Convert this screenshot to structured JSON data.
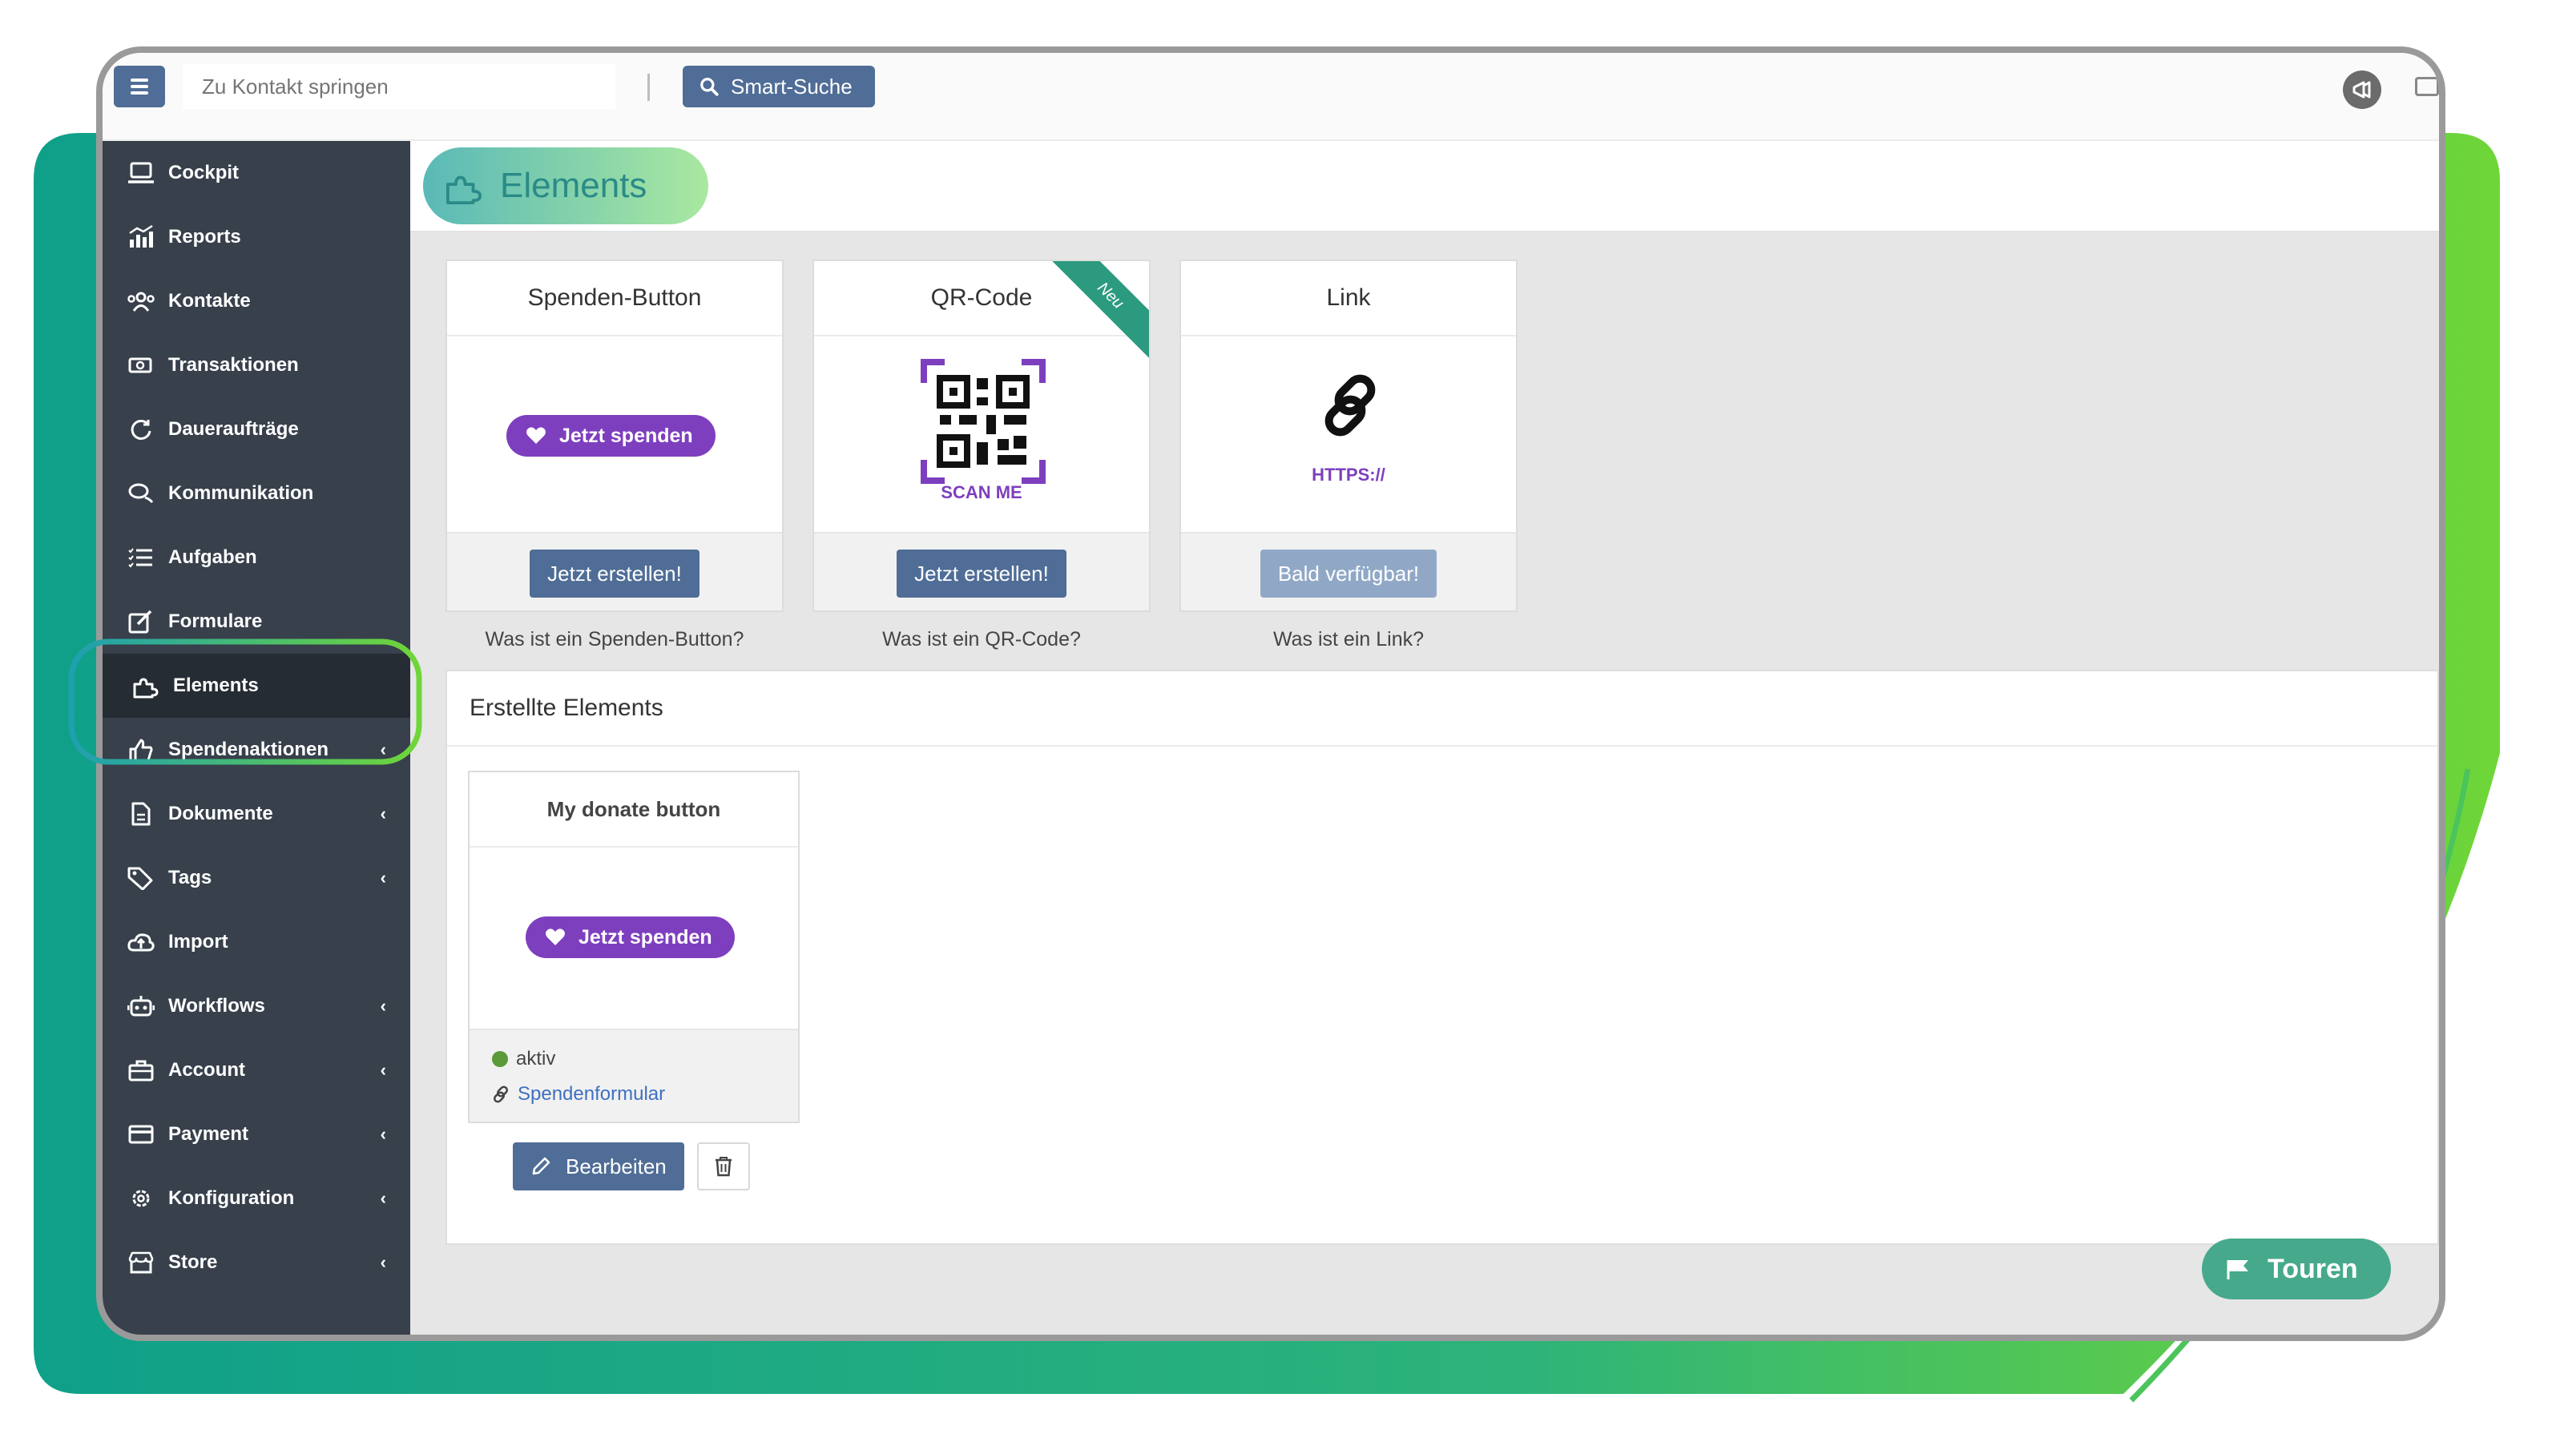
{
  "topbar": {
    "search_placeholder": "Zu Kontakt springen",
    "smart_search_label": "Smart-Suche"
  },
  "sidebar": {
    "items": [
      {
        "label": "Cockpit",
        "icon": "laptop-icon",
        "has_submenu": false
      },
      {
        "label": "Reports",
        "icon": "chart-icon",
        "has_submenu": false
      },
      {
        "label": "Kontakte",
        "icon": "users-icon",
        "has_submenu": false
      },
      {
        "label": "Transaktionen",
        "icon": "money-icon",
        "has_submenu": false
      },
      {
        "label": "Daueraufträge",
        "icon": "recurring-icon",
        "has_submenu": false
      },
      {
        "label": "Kommunikation",
        "icon": "chat-icon",
        "has_submenu": false
      },
      {
        "label": "Aufgaben",
        "icon": "tasks-icon",
        "has_submenu": false
      },
      {
        "label": "Formulare",
        "icon": "form-icon",
        "has_submenu": false
      },
      {
        "label": "Elements",
        "icon": "puzzle-icon",
        "has_submenu": false,
        "active": true
      },
      {
        "label": "Spendenaktionen",
        "icon": "thumbs-up-icon",
        "has_submenu": true
      },
      {
        "label": "Dokumente",
        "icon": "document-icon",
        "has_submenu": true
      },
      {
        "label": "Tags",
        "icon": "tag-icon",
        "has_submenu": true
      },
      {
        "label": "Import",
        "icon": "cloud-upload-icon",
        "has_submenu": false
      },
      {
        "label": "Workflows",
        "icon": "robot-icon",
        "has_submenu": true
      },
      {
        "label": "Account",
        "icon": "briefcase-icon",
        "has_submenu": true
      },
      {
        "label": "Payment",
        "icon": "credit-card-icon",
        "has_submenu": true
      },
      {
        "label": "Konfiguration",
        "icon": "gear-icon",
        "has_submenu": true
      },
      {
        "label": "Store",
        "icon": "store-icon",
        "has_submenu": true
      }
    ],
    "chevron": "‹"
  },
  "page": {
    "title": "Elements"
  },
  "element_types": [
    {
      "title": "Spenden-Button",
      "preview_label": "Jetzt spenden",
      "button": "Jetzt erstellen!",
      "caption": "Was ist ein Spenden-Button?"
    },
    {
      "title": "QR-Code",
      "preview_label": "SCAN ME",
      "ribbon": "Neu",
      "button": "Jetzt erstellen!",
      "caption": "Was ist ein QR-Code?"
    },
    {
      "title": "Link",
      "preview_label": "HTTPS://",
      "button": "Bald verfügbar!",
      "caption": "Was ist ein Link?"
    }
  ],
  "created": {
    "section_title": "Erstellte Elements",
    "items": [
      {
        "title": "My donate button",
        "preview_label": "Jetzt spenden",
        "status": "aktiv",
        "link_label": "Spendenformular",
        "edit_label": "Bearbeiten"
      }
    ]
  },
  "touren_label": "Touren",
  "colors": {
    "sidebar": "#37404b",
    "primary_button": "#4f6d96",
    "donate_purple": "#7d3fbe",
    "status_green": "#5b9a38",
    "brand_teal": "#11a28a",
    "brand_green": "#6fd638"
  }
}
